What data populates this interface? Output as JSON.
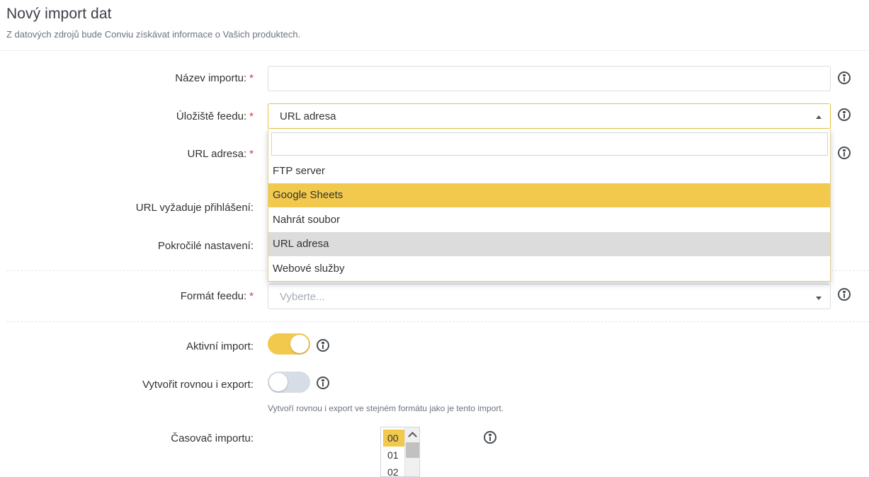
{
  "header": {
    "title": "Nový import dat",
    "subtitle": "Z datových zdrojů bude Conviu získávat informace o Vašich produktech."
  },
  "form": {
    "import_name": {
      "label": "Název importu:",
      "required_mark": "*",
      "value": ""
    },
    "feed_storage": {
      "label": "Úložiště feedu:",
      "required_mark": "*",
      "selected": "URL adresa"
    },
    "url": {
      "label": "URL adresa:",
      "required_mark": "*"
    },
    "url_login": {
      "label": "URL vyžaduje přihlášení:"
    },
    "advanced": {
      "label": "Pokročilé nastavení:"
    },
    "feed_format": {
      "label": "Formát feedu:",
      "required_mark": "*",
      "placeholder": "Vyberte..."
    },
    "active_import": {
      "label": "Aktivní import:",
      "on": true
    },
    "create_export": {
      "label": "Vytvořit rovnou i export:",
      "on": false,
      "helper": "Vytvoří rovnou i export ve stejném formátu jako je tento import."
    },
    "timer": {
      "label": "Časovač importu:",
      "options": [
        "00",
        "01",
        "02"
      ],
      "selected": "00"
    }
  },
  "dropdown": {
    "search_value": "",
    "options": [
      {
        "label": "FTP server",
        "state": "normal"
      },
      {
        "label": "Google Sheets",
        "state": "highlight"
      },
      {
        "label": "Nahrát soubor",
        "state": "normal"
      },
      {
        "label": "URL adresa",
        "state": "selected"
      },
      {
        "label": "Webové služby",
        "state": "normal"
      }
    ]
  },
  "colors": {
    "accent": "#f2c94c",
    "required": "#e2333c",
    "selected_option": "#dcdcdc",
    "toggle_off": "#d6dde6"
  },
  "icons": {
    "info": "info-circle-icon",
    "caret_up": "caret-up-icon",
    "caret_down": "caret-down-icon"
  }
}
